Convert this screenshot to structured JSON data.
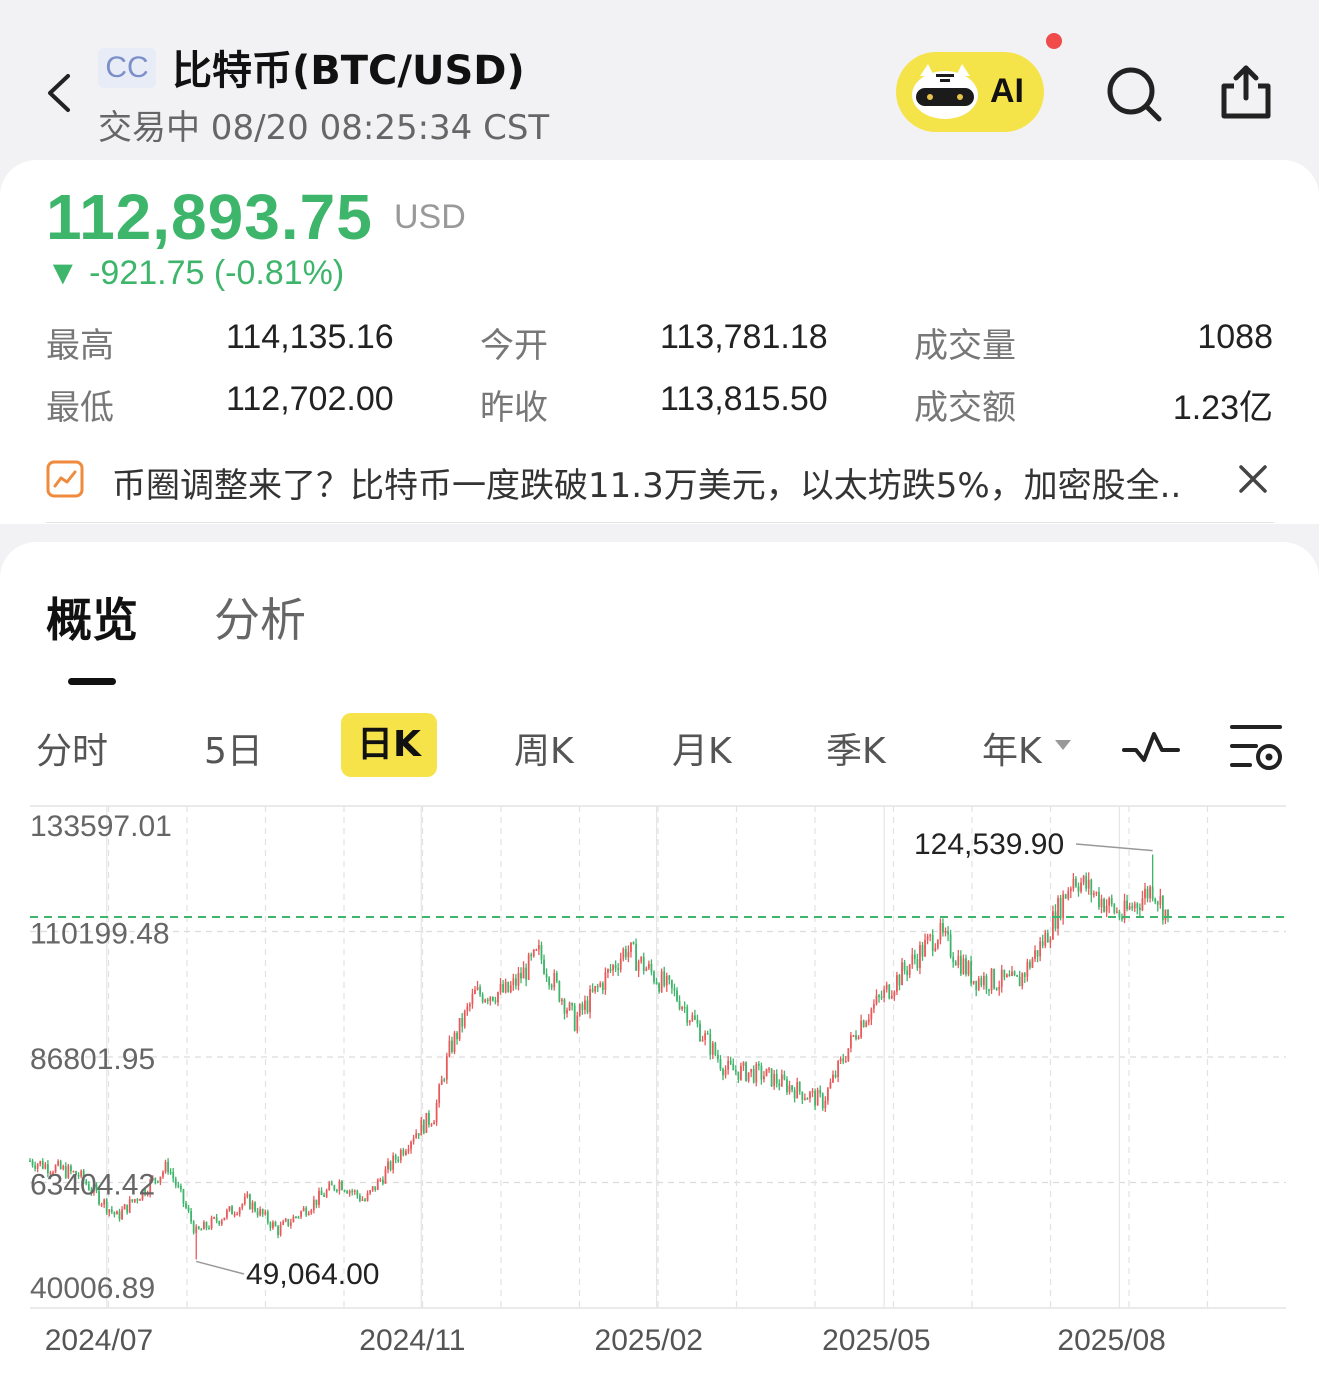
{
  "header": {
    "badge": "CC",
    "title": "比特币(BTC/USD)",
    "status": "交易中 08/20 08:25:34 CST",
    "ai_label": "AI"
  },
  "quote": {
    "price": "112,893.75",
    "unit": "USD",
    "change": "▼ -921.75 (-0.81%)",
    "stats": [
      {
        "label": "最高",
        "value": "114,135.16"
      },
      {
        "label": "今开",
        "value": "113,781.18"
      },
      {
        "label": "成交量",
        "value": "1088"
      },
      {
        "label": "最低",
        "value": "112,702.00"
      },
      {
        "label": "昨收",
        "value": "113,815.50"
      },
      {
        "label": "成交额",
        "value": "1.23亿"
      }
    ]
  },
  "news": {
    "text": "币圈调整来了？比特币一度跌破11.3万美元，以太坊跌5%，加密股全.."
  },
  "tabs": [
    {
      "label": "概览",
      "active": true
    },
    {
      "label": "分析",
      "active": false
    }
  ],
  "periods": [
    "分时",
    "5日",
    "日K",
    "周K",
    "月K",
    "季K",
    "年K"
  ],
  "active_period": "日K",
  "colors": {
    "up": "#e85a5a",
    "down": "#3db56a",
    "accent": "#f6e34a"
  },
  "chart_data": {
    "type": "candlestick",
    "y_tick_labels": [
      "133597.01",
      "110199.48",
      "86801.95",
      "63404.42",
      "40006.89"
    ],
    "ylim": [
      40006.89,
      133597.01
    ],
    "x_tick_labels": [
      "2024/07",
      "2024/11",
      "2025/02",
      "2025/05",
      "2025/08"
    ],
    "x_range": [
      "2024-06-01",
      "2025-08-20"
    ],
    "current_price": 112893.75,
    "max_label": "124,539.90",
    "max_value": 124539.9,
    "max_date": "2025-08-14",
    "min_label": "49,064.00",
    "min_value": 49064.0,
    "min_date": "2024-08-05",
    "close_series": [
      {
        "date": "2024-06-01",
        "close": 67500
      },
      {
        "date": "2024-06-20",
        "close": 64800
      },
      {
        "date": "2024-07-05",
        "close": 57000
      },
      {
        "date": "2024-07-25",
        "close": 66500
      },
      {
        "date": "2024-08-05",
        "close": 54000
      },
      {
        "date": "2024-08-25",
        "close": 60000
      },
      {
        "date": "2024-09-06",
        "close": 54500
      },
      {
        "date": "2024-09-30",
        "close": 63500
      },
      {
        "date": "2024-10-10",
        "close": 60000
      },
      {
        "date": "2024-10-29",
        "close": 72500
      },
      {
        "date": "2024-11-06",
        "close": 76000
      },
      {
        "date": "2024-11-12",
        "close": 88000
      },
      {
        "date": "2024-11-22",
        "close": 98500
      },
      {
        "date": "2024-12-05",
        "close": 99000
      },
      {
        "date": "2024-12-17",
        "close": 106000
      },
      {
        "date": "2024-12-31",
        "close": 93500
      },
      {
        "date": "2025-01-20",
        "close": 107000
      },
      {
        "date": "2025-02-10",
        "close": 97500
      },
      {
        "date": "2025-02-28",
        "close": 84500
      },
      {
        "date": "2025-03-15",
        "close": 83500
      },
      {
        "date": "2025-04-07",
        "close": 78500
      },
      {
        "date": "2025-04-22",
        "close": 93500
      },
      {
        "date": "2025-05-09",
        "close": 103000
      },
      {
        "date": "2025-05-22",
        "close": 110000
      },
      {
        "date": "2025-06-05",
        "close": 101500
      },
      {
        "date": "2025-06-22",
        "close": 100500
      },
      {
        "date": "2025-07-03",
        "close": 109000
      },
      {
        "date": "2025-07-14",
        "close": 120500
      },
      {
        "date": "2025-08-02",
        "close": 113000
      },
      {
        "date": "2025-08-14",
        "close": 118500
      },
      {
        "date": "2025-08-20",
        "close": 112893.75
      }
    ]
  }
}
